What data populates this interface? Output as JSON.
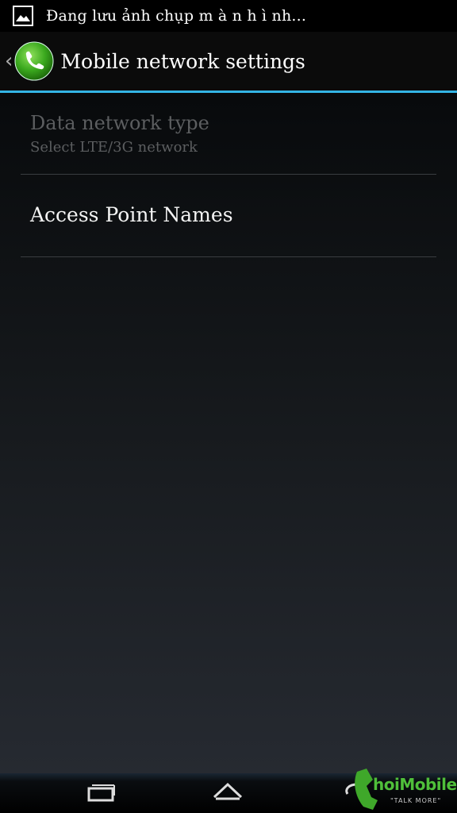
{
  "status_bar": {
    "notification_text": "Đang lưu ảnh chụp m à n h ì nh...",
    "icon": "image-icon"
  },
  "action_bar": {
    "title": "Mobile network settings",
    "back_icon": "chevron-left-icon",
    "app_icon": "phone-icon",
    "accent_color": "#33b5e5"
  },
  "preferences": [
    {
      "title": "Data network type",
      "summary": "Select LTE/3G network",
      "enabled": false
    },
    {
      "title": "Access Point Names",
      "enabled": true
    }
  ],
  "nav_bar": {
    "buttons": [
      "recent-apps-icon",
      "home-icon",
      "back-icon"
    ]
  },
  "watermark": {
    "brand": "hoiMobile",
    "tagline": "\"TALK MORE\""
  }
}
